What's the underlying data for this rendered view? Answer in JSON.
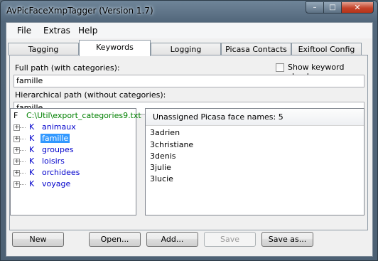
{
  "window": {
    "title": "AvPicFaceXmpTagger (Version 1.7)"
  },
  "menu": [
    "File",
    "Extras",
    "Help"
  ],
  "tabs": [
    {
      "label": "Tagging",
      "active": false
    },
    {
      "label": "Keywords",
      "active": true
    },
    {
      "label": "Logging",
      "active": false
    },
    {
      "label": "Picasa Contacts",
      "active": false
    },
    {
      "label": "Exiftool Config",
      "active": false
    }
  ],
  "keywords": {
    "full_path_label": "Full path (with categories):",
    "full_path_value": "famille",
    "show_cloud_label": "Show keyword cloud",
    "show_cloud_checked": false,
    "hier_path_label": "Hierarchical path (without categories):",
    "hier_path_value": "famille"
  },
  "tree": {
    "root": {
      "type": "F",
      "label": "C:\\Util\\export_categories9.txt",
      "color": "#008000"
    },
    "items": [
      {
        "type": "K",
        "label": "animaux",
        "selected": false
      },
      {
        "type": "K",
        "label": "famille",
        "selected": true
      },
      {
        "type": "K",
        "label": "groupes",
        "selected": false
      },
      {
        "type": "K",
        "label": "loisirs",
        "selected": false
      },
      {
        "type": "K",
        "label": "orchidees",
        "selected": false
      },
      {
        "type": "K",
        "label": "voyage",
        "selected": false
      }
    ]
  },
  "faces": {
    "header": "Unassigned Picasa face names: 5",
    "items": [
      "3adrien",
      "3christiane",
      "3denis",
      "3julie",
      "3lucie"
    ]
  },
  "buttons": {
    "new": "New",
    "open": "Open...",
    "add": "Add...",
    "save": "Save",
    "save_disabled": true,
    "save_as": "Save as..."
  }
}
